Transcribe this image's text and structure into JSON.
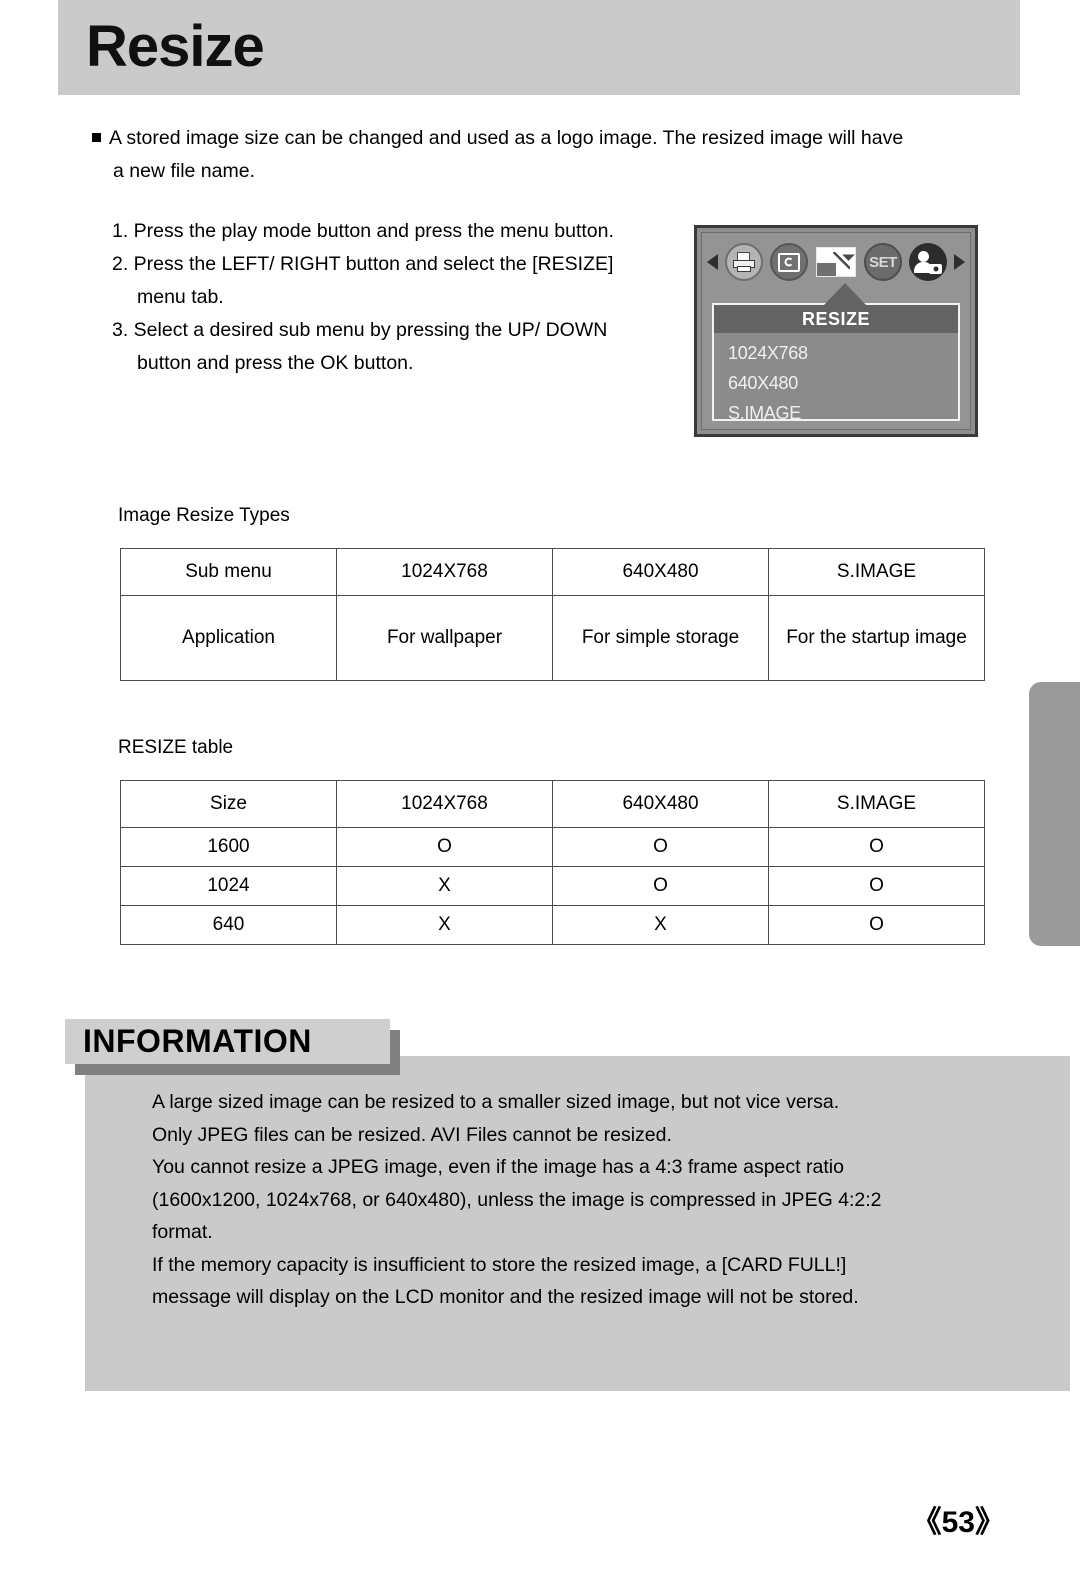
{
  "header": {
    "title": "Resize"
  },
  "intro": {
    "bullet_icon": "square-bullet-icon",
    "line1": "A stored image size can be changed and used as a logo image. The resized image will have",
    "line2": "a new file name."
  },
  "steps": [
    "1. Press the play mode button and press the menu button.",
    "2. Press the LEFT/ RIGHT button and select the [RESIZE]",
    "menu tab.",
    "3. Select a desired sub menu by pressing the UP/ DOWN",
    "button and press the OK button."
  ],
  "lcd": {
    "tabs": [
      {
        "name": "left-arrow-icon",
        "label": ""
      },
      {
        "name": "print-icon",
        "label": ""
      },
      {
        "name": "rotate-icon",
        "label": ""
      },
      {
        "name": "resize-icon",
        "label": ""
      },
      {
        "name": "set-icon",
        "label": "SET"
      },
      {
        "name": "startup-image-icon",
        "label": ""
      },
      {
        "name": "right-arrow-icon",
        "label": ""
      }
    ],
    "menu_title": "RESIZE",
    "menu_items": [
      "1024X768",
      "640X480",
      "S.IMAGE"
    ]
  },
  "types_section": {
    "caption": "Image Resize Types",
    "headers": [
      "Sub menu",
      "1024X768",
      "640X480",
      "S.IMAGE"
    ],
    "row": [
      "Application",
      "For wallpaper",
      "For simple\nstorage",
      "For the startup image"
    ],
    "row_cells": [
      "Application",
      "For wallpaper",
      "For simple storage",
      "For the startup image"
    ]
  },
  "resize_section": {
    "caption": "RESIZE table",
    "headers": [
      "Size",
      "1024X768",
      "640X480",
      "S.IMAGE"
    ],
    "rows": [
      [
        "1600",
        "O",
        "O",
        "O"
      ],
      [
        "1024",
        "X",
        "O",
        "O"
      ],
      [
        "640",
        "X",
        "X",
        "O"
      ]
    ]
  },
  "information": {
    "label": "INFORMATION",
    "lines": [
      "A large sized image can be resized to a smaller sized image, but not vice versa.",
      "Only JPEG files can be resized. AVI Files cannot be resized.",
      "You cannot resize a JPEG image, even if the image has a 4:3 frame aspect ratio",
      "(1600x1200, 1024x768, or 640x480), unless the image is compressed in JPEG 4:2:2",
      "format.",
      "If the memory capacity is insufficient to store the resized image, a [CARD FULL!]",
      "message will display on the LCD monitor and the resized image will not be stored."
    ]
  },
  "footer": {
    "page_number": "《53》"
  },
  "colors": {
    "header_bg": "#cacaca",
    "info_bg": "#cacaca",
    "info_label_bg": "#cfcfcf",
    "info_shadow": "#808080",
    "lcd_bg": "#949494",
    "lcd_menu_title_bg": "#636363",
    "thumb_tab": "#9a9a9a"
  }
}
